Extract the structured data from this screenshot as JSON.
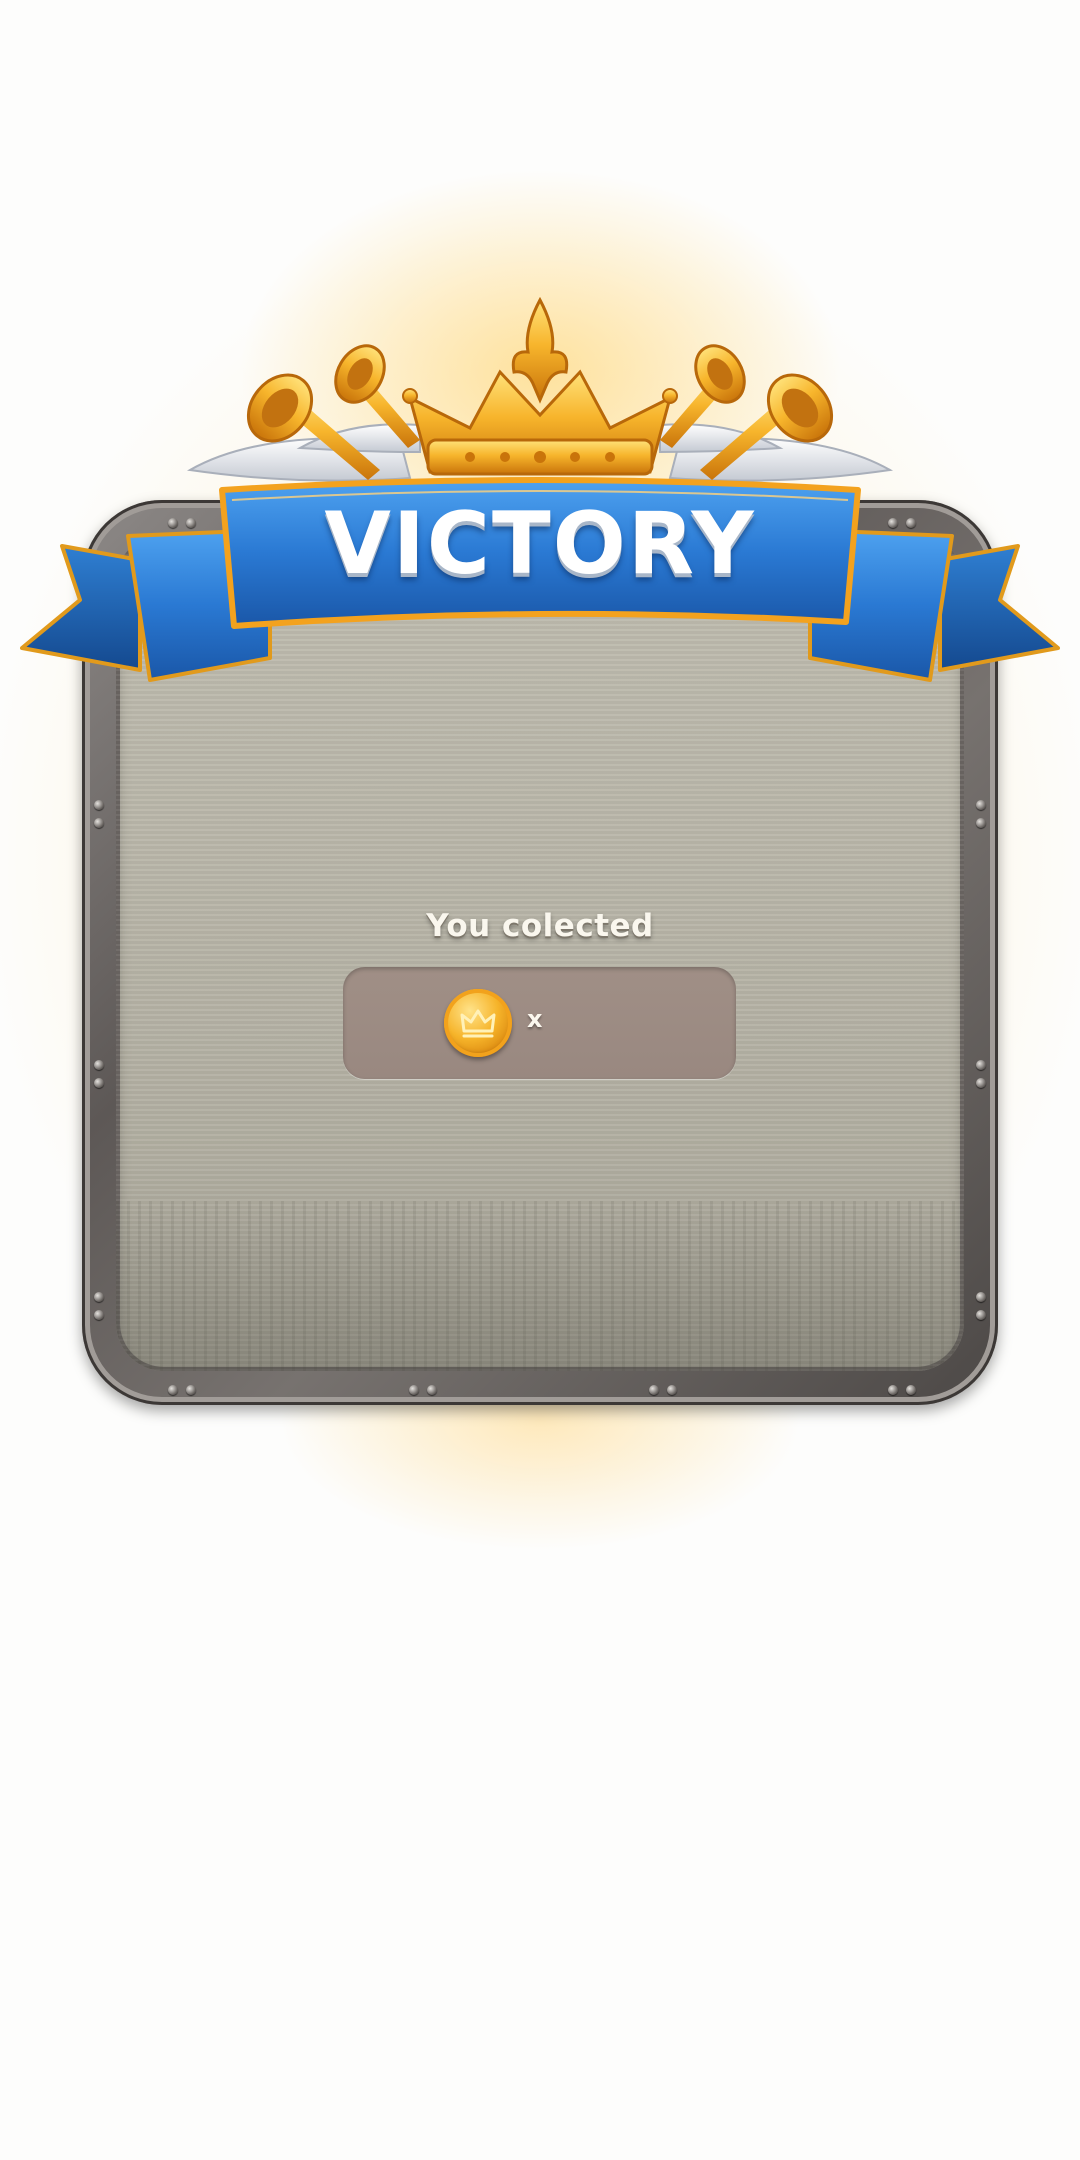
{
  "screen": {
    "title": "VICTORY",
    "collected_label": "You colected",
    "reward": {
      "icon": "crown-coin-icon",
      "multiplier": "x"
    }
  },
  "colors": {
    "banner_blue": "#2f7fd8",
    "banner_trim": "#f3a21e",
    "crown_gold": "#f4b12a",
    "panel_stone": "#bab7aa",
    "frame_metal": "#6b6663",
    "reward_box": "#9d8c84"
  }
}
